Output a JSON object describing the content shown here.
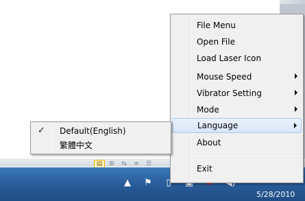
{
  "menu": {
    "items": [
      {
        "label": "File Menu"
      },
      {
        "label": "Open File"
      },
      {
        "label": "Load Laser Icon"
      },
      {
        "label": "Mouse Speed",
        "has_submenu": true
      },
      {
        "label": "Vibrator Setting",
        "has_submenu": true
      },
      {
        "label": "Mode",
        "has_submenu": true
      },
      {
        "label": "Language",
        "has_submenu": true,
        "highlighted": true
      },
      {
        "label": "About"
      },
      {
        "label": "Exit"
      }
    ]
  },
  "language_submenu": {
    "items": [
      {
        "label": "Default(English)",
        "checked": true,
        "check_glyph": "✓"
      },
      {
        "label": "繁體中文",
        "checked": false
      }
    ]
  },
  "taskbar": {
    "clock": "5/28/2010",
    "icons": [
      "show-hidden-icons-arrow",
      "action-center-flag-icon",
      "device-icon",
      "network-icon",
      "battery-warning-icon",
      "volume-icon"
    ]
  },
  "colors": {
    "menu_bg": "#f0f0f0",
    "highlight_border": "#a8c8ef",
    "taskbar": "#2a5e9c"
  }
}
